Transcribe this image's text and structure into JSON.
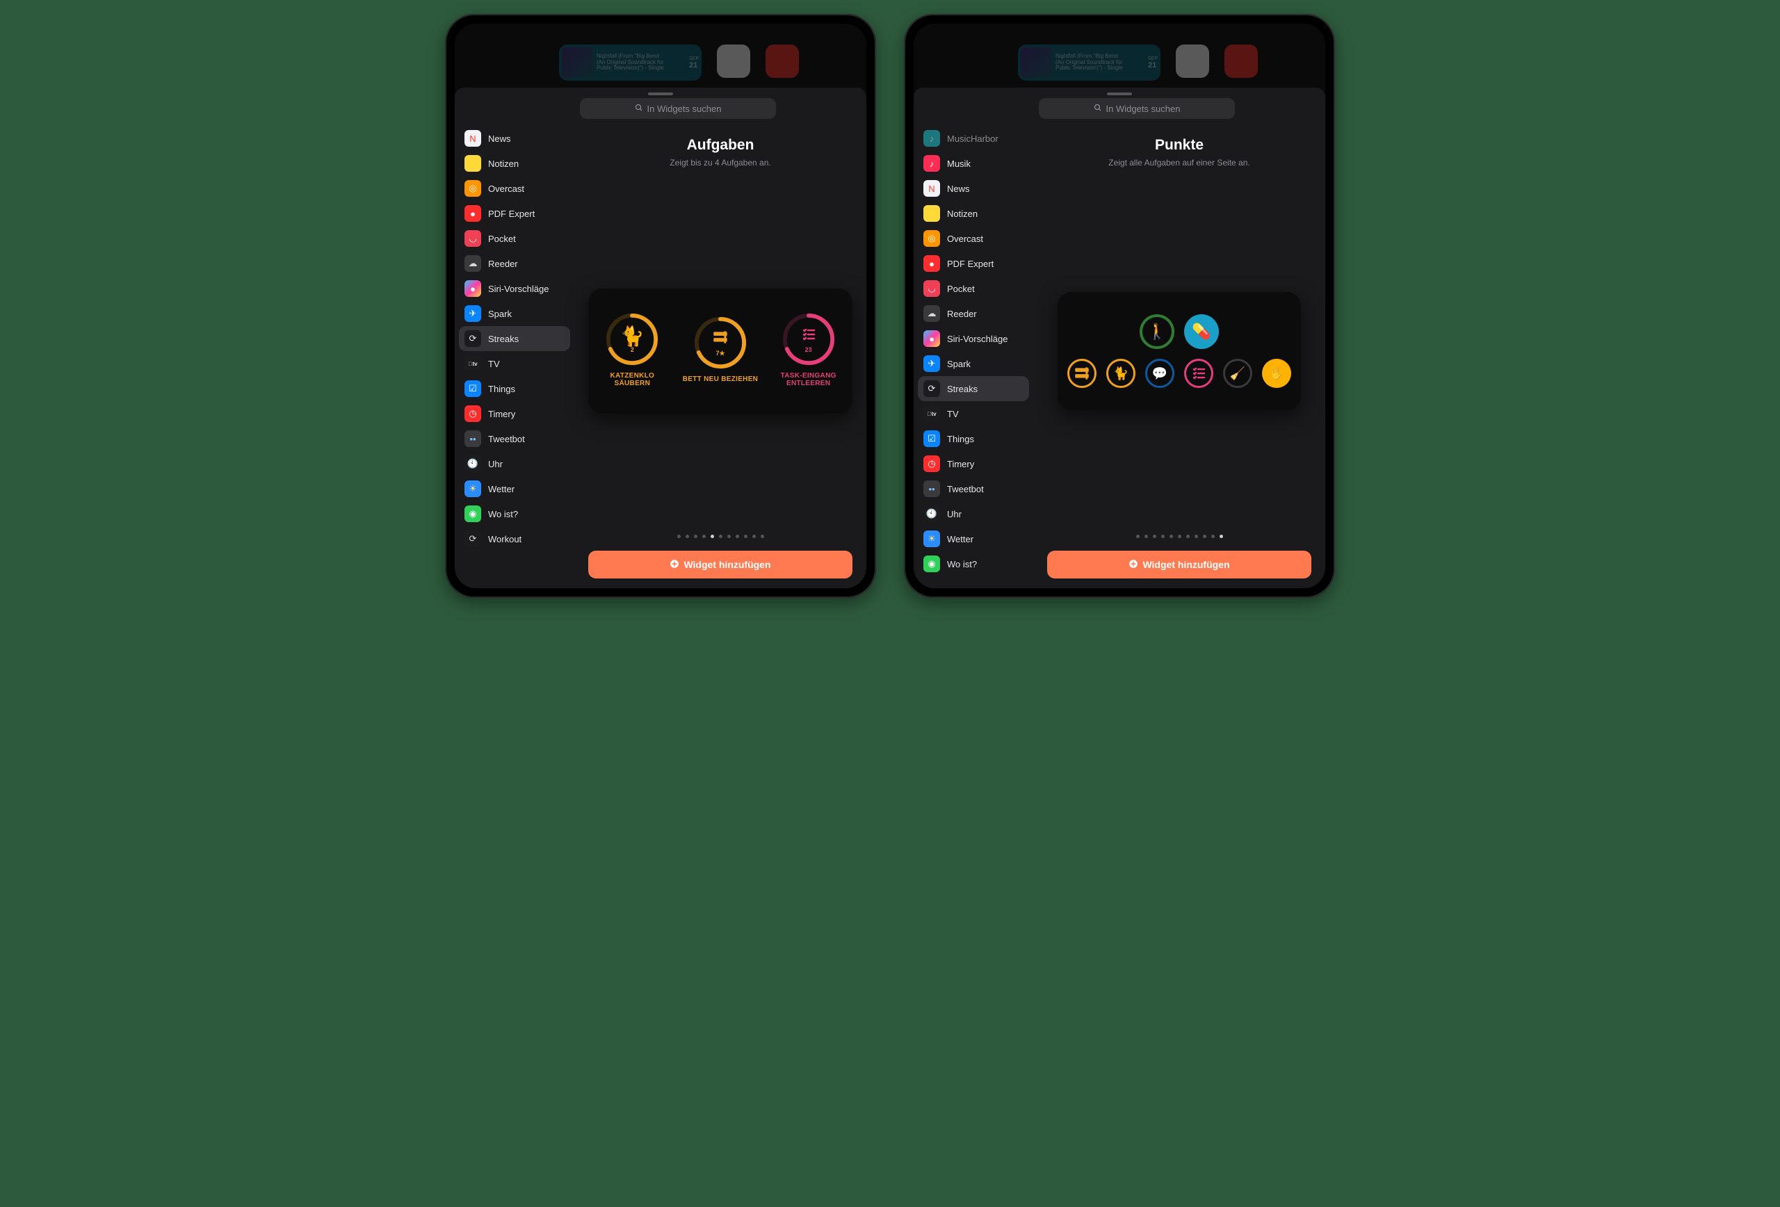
{
  "search_placeholder": "In Widgets suchen",
  "add_button": "Widget hinzufügen",
  "music_widget": {
    "line1": "Nightfall (From \"Big Bend",
    "line2": "(An Original Soundtrack for",
    "line3": "Public Television)\") - Single",
    "month": "SEP",
    "day": "21"
  },
  "left": {
    "apps": [
      {
        "name": "News",
        "bg": "#f2f2f7",
        "fg": "#ff3b30",
        "glyph": "N"
      },
      {
        "name": "Notizen",
        "bg": "#ffd93a",
        "fg": "#5a4b00",
        "glyph": ""
      },
      {
        "name": "Overcast",
        "bg": "#ff9500",
        "fg": "#fff",
        "glyph": "◎"
      },
      {
        "name": "PDF Expert",
        "bg": "#ff2d2d",
        "fg": "#fff",
        "glyph": "●"
      },
      {
        "name": "Pocket",
        "bg": "#ef4056",
        "fg": "#fff",
        "glyph": "◡"
      },
      {
        "name": "Reeder",
        "bg": "#3a3a3c",
        "fg": "#d8d8d8",
        "glyph": "☁"
      },
      {
        "name": "Siri-Vorschläge",
        "bg": "linear-gradient(135deg,#34c2ff,#ff3ea5,#ffd33d)",
        "fg": "#fff",
        "glyph": "●"
      },
      {
        "name": "Spark",
        "bg": "#0a84ff",
        "fg": "#fff",
        "glyph": "✈"
      },
      {
        "name": "Streaks",
        "bg": "#1c1c1e",
        "fg": "#e5e5e7",
        "glyph": "⟳",
        "selected": true
      },
      {
        "name": "TV",
        "bg": "#1c1c1e",
        "fg": "#e5e5e7",
        "glyph": "tv"
      },
      {
        "name": "Things",
        "bg": "#0a84ff",
        "fg": "#fff",
        "glyph": "☑"
      },
      {
        "name": "Timery",
        "bg": "#ff2d2d",
        "fg": "#fff",
        "glyph": "◷"
      },
      {
        "name": "Tweetbot",
        "bg": "#3a3a3c",
        "fg": "#7cc3ff",
        "glyph": "••"
      },
      {
        "name": "Uhr",
        "bg": "#1c1c1e",
        "fg": "#fff",
        "glyph": "🕙"
      },
      {
        "name": "Wetter",
        "bg": "#2b8cff",
        "fg": "#ffe26a",
        "glyph": "☀"
      },
      {
        "name": "Wo ist?",
        "bg": "#30d158",
        "fg": "#fff",
        "glyph": "◉"
      },
      {
        "name": "Workout",
        "bg": "#1c1c1e",
        "fg": "#d8d8d8",
        "glyph": "⟳"
      }
    ],
    "widget_title": "Aufgaben",
    "widget_subtitle": "Zeigt bis zu 4 Aufgaben an.",
    "page_dots": {
      "total": 11,
      "active": 4
    },
    "tasks": [
      {
        "label": "KATZENKLO SÄUBERN",
        "count": "2",
        "color": "#f0a020",
        "glyph": "🐈"
      },
      {
        "label": "BETT NEU BEZIEHEN",
        "count": "7★",
        "color": "#f0a020",
        "glyph": "bed"
      },
      {
        "label": "TASK-EINGANG ENTLEEREN",
        "count": "23",
        "color": "#e63e7b",
        "glyph": "list"
      }
    ]
  },
  "right": {
    "apps": [
      {
        "name": "MusicHarbor",
        "bg": "#20c3d0",
        "fg": "#fff",
        "glyph": "♪",
        "dim": true
      },
      {
        "name": "Musik",
        "bg": "#ff2d55",
        "fg": "#fff",
        "glyph": "♪"
      },
      {
        "name": "News",
        "bg": "#f2f2f7",
        "fg": "#ff3b30",
        "glyph": "N"
      },
      {
        "name": "Notizen",
        "bg": "#ffd93a",
        "fg": "#5a4b00",
        "glyph": ""
      },
      {
        "name": "Overcast",
        "bg": "#ff9500",
        "fg": "#fff",
        "glyph": "◎"
      },
      {
        "name": "PDF Expert",
        "bg": "#ff2d2d",
        "fg": "#fff",
        "glyph": "●"
      },
      {
        "name": "Pocket",
        "bg": "#ef4056",
        "fg": "#fff",
        "glyph": "◡"
      },
      {
        "name": "Reeder",
        "bg": "#3a3a3c",
        "fg": "#d8d8d8",
        "glyph": "☁"
      },
      {
        "name": "Siri-Vorschläge",
        "bg": "linear-gradient(135deg,#34c2ff,#ff3ea5,#ffd33d)",
        "fg": "#fff",
        "glyph": "●"
      },
      {
        "name": "Spark",
        "bg": "#0a84ff",
        "fg": "#fff",
        "glyph": "✈"
      },
      {
        "name": "Streaks",
        "bg": "#1c1c1e",
        "fg": "#e5e5e7",
        "glyph": "⟳",
        "selected": true
      },
      {
        "name": "TV",
        "bg": "#1c1c1e",
        "fg": "#e5e5e7",
        "glyph": "tv"
      },
      {
        "name": "Things",
        "bg": "#0a84ff",
        "fg": "#fff",
        "glyph": "☑"
      },
      {
        "name": "Timery",
        "bg": "#ff2d2d",
        "fg": "#fff",
        "glyph": "◷"
      },
      {
        "name": "Tweetbot",
        "bg": "#3a3a3c",
        "fg": "#7cc3ff",
        "glyph": "••"
      },
      {
        "name": "Uhr",
        "bg": "#1c1c1e",
        "fg": "#fff",
        "glyph": "🕙"
      },
      {
        "name": "Wetter",
        "bg": "#2b8cff",
        "fg": "#ffe26a",
        "glyph": "☀"
      },
      {
        "name": "Wo ist?",
        "bg": "#30d158",
        "fg": "#fff",
        "glyph": "◉"
      }
    ],
    "widget_title": "Punkte",
    "widget_subtitle": "Zeigt alle Aufgaben auf einer Seite an.",
    "page_dots": {
      "total": 11,
      "active": 10
    },
    "points_top": [
      {
        "border": "#2e7d32",
        "glyph": "🚶",
        "fill": ""
      },
      {
        "border": "",
        "glyph": "💊",
        "fill": "#1aa0c8"
      }
    ],
    "points_bottom": [
      {
        "border": "#f0a020",
        "glyph": "bed"
      },
      {
        "border": "#f0a020",
        "glyph": "🐈"
      },
      {
        "border": "#0a5aa0",
        "glyph": "💬",
        "glyphColor": "#1e88ff"
      },
      {
        "border": "#e63e7b",
        "glyph": "list"
      },
      {
        "border": "#3a3a3c",
        "glyph": "🧹",
        "glyphColor": "#555"
      },
      {
        "border": "",
        "glyph": "✋",
        "fill": "#ffb300"
      }
    ]
  }
}
